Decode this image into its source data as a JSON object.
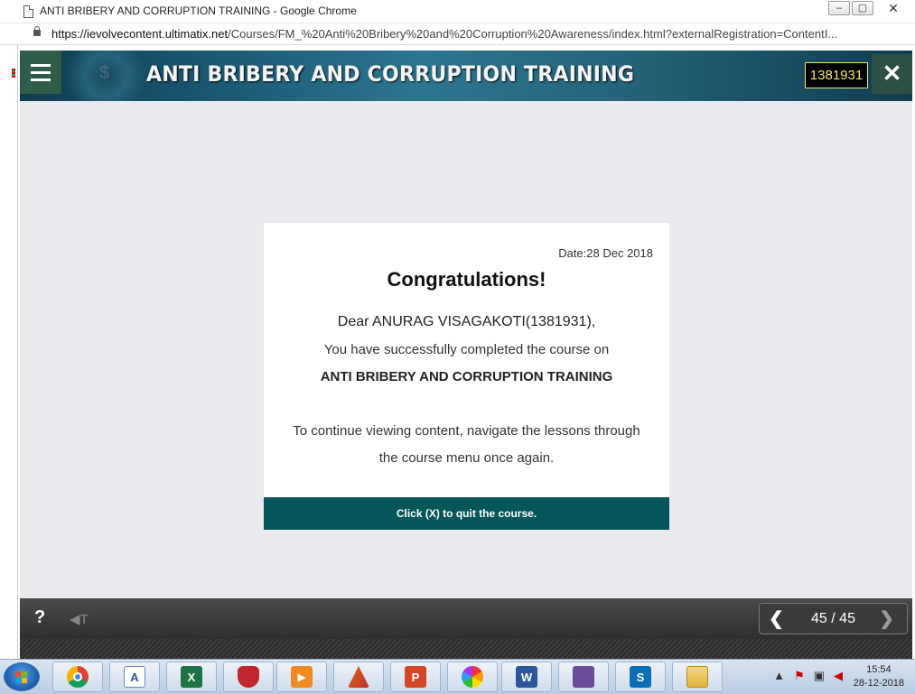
{
  "window": {
    "title": "ANTI BRIBERY AND CORRUPTION TRAINING - Google Chrome",
    "minimize": "▭",
    "maximize": "▢",
    "close": "✕"
  },
  "address": {
    "url_domain": "https://ievolvecontent.ultimatix.net",
    "url_path": "/Courses/FM_%20Anti%20Bribery%20and%20Corruption%20Awareness/index.html?externalRegistration=ContentI..."
  },
  "course": {
    "title": "ANTI BRIBERY AND CORRUPTION TRAINING",
    "learner_id": "1381931",
    "close_glyph": "✕",
    "header_watermark": "$"
  },
  "certificate": {
    "date": "Date:28 Dec 2018",
    "heading": "Congratulations!",
    "greeting": "Dear ANURAG VISAGAKOTI(1381931),",
    "completed": "You have successfully completed the course on",
    "course_name": "ANTI BRIBERY AND CORRUPTION TRAINING",
    "continue_line1": "To continue viewing content, navigate the lessons through",
    "continue_line2": "the course menu once again.",
    "quit": "Click (X) to quit the course."
  },
  "player": {
    "help": "?",
    "audio_glyph": "◀T",
    "prev_glyph": "❮",
    "next_glyph": "❯",
    "page": "45 / 45"
  },
  "taskbar": {
    "apps": [
      {
        "name": "chrome",
        "label": ""
      },
      {
        "name": "word-doc",
        "label": "A"
      },
      {
        "name": "excel",
        "label": "X"
      },
      {
        "name": "security",
        "label": ""
      },
      {
        "name": "media",
        "label": "▶"
      },
      {
        "name": "matlab",
        "label": ""
      },
      {
        "name": "powerpoint",
        "label": "P"
      },
      {
        "name": "photos",
        "label": ""
      },
      {
        "name": "word",
        "label": "W"
      },
      {
        "name": "movie",
        "label": ""
      },
      {
        "name": "sharepoint",
        "label": "S"
      },
      {
        "name": "explorer",
        "label": ""
      }
    ],
    "time": "15:54",
    "date": "28-12-2018"
  }
}
